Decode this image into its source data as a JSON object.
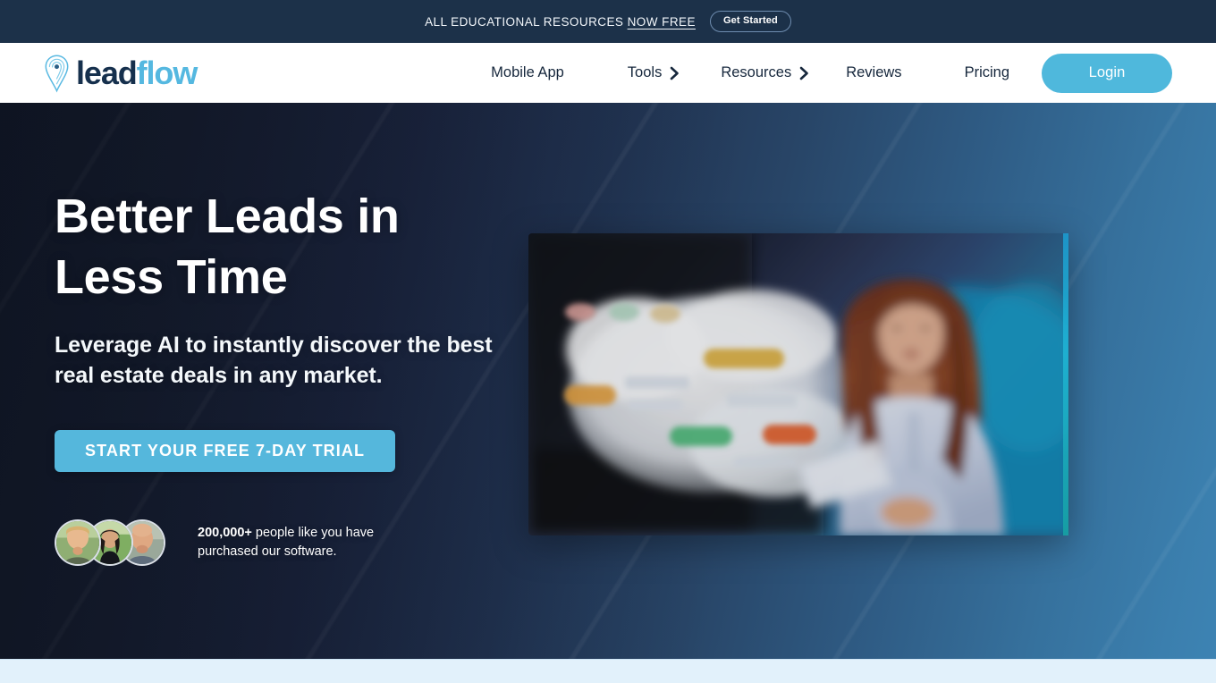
{
  "announcement": {
    "text_lead": "ALL EDUCATIONAL RESOURCES ",
    "text_emph": "NOW FREE",
    "cta_label": "Get Started"
  },
  "header": {
    "logo": {
      "text_primary": "lead",
      "text_secondary": "flow",
      "mark_name": "location-pin-fingerprint-icon"
    },
    "nav": [
      {
        "label": "Mobile App",
        "has_chevron": false
      },
      {
        "label": "Tools",
        "has_chevron": true
      },
      {
        "label": "Resources",
        "has_chevron": true
      },
      {
        "label": "Reviews",
        "has_chevron": false
      },
      {
        "label": "Pricing",
        "has_chevron": false
      }
    ],
    "login_label": "Login"
  },
  "hero": {
    "title_line1": "Better Leads in",
    "title_line2": "Less Time",
    "subtitle": "Leverage AI to instantly discover the best real estate deals in any market.",
    "cta_label": "START YOUR FREE 7-DAY TRIAL",
    "social_proof": {
      "count": "200,000+",
      "text": " people like you have purchased our software."
    },
    "media_alt": "Woman holding tablet with floating AI lead dashboard graphic"
  },
  "colors": {
    "announce_bg": "#1c3149",
    "brand_blue": "#55b8e0",
    "login_blue": "#4fb8dc",
    "cta_blue": "#55b7dc",
    "logo_navy": "#16304d",
    "nav_text": "#16273c",
    "hero_dark": "#141c2e",
    "hero_light": "#3d83b3",
    "next_section_bg": "#e2f1fb"
  }
}
